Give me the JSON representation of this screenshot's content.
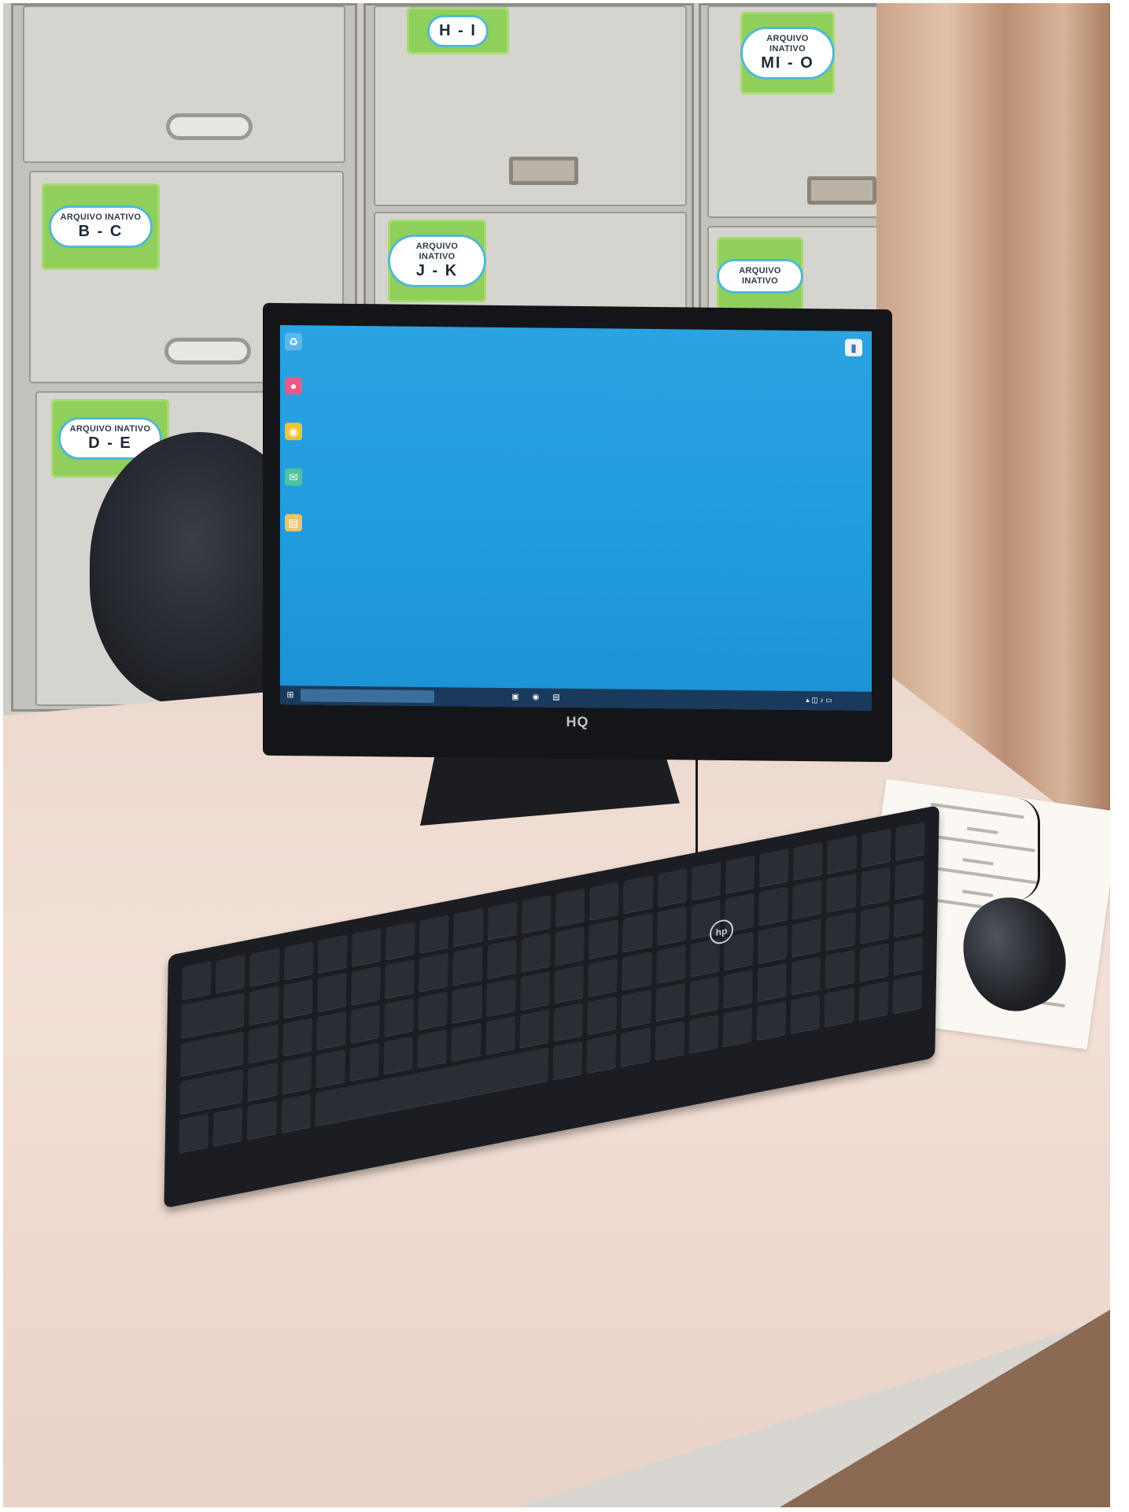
{
  "scene": {
    "labels": [
      {
        "title": "ARQUIVO INATIVO",
        "range": "B - C"
      },
      {
        "title": "ARQUIVO INATIVO",
        "range": "D - E"
      },
      {
        "title": "",
        "range": "H - I"
      },
      {
        "title": "ARQUIVO INATIVO",
        "range": "J - K"
      },
      {
        "title": "ARQUIVO INATIVO",
        "range": "MI - O"
      },
      {
        "title": "ARQUIVO INATIVO",
        "range": ""
      }
    ],
    "monitor_brand": "HQ",
    "keyboard_brand": "hp"
  },
  "colors": {
    "desktop_wallpaper": "#1f9bdd",
    "label_card": "#8fcf5b",
    "desk_surface": "#f2dfd6"
  },
  "icons": [
    "recycle-bin-icon",
    "app-icon",
    "chrome-icon",
    "chat-icon",
    "folder-icon",
    "file-icon"
  ]
}
